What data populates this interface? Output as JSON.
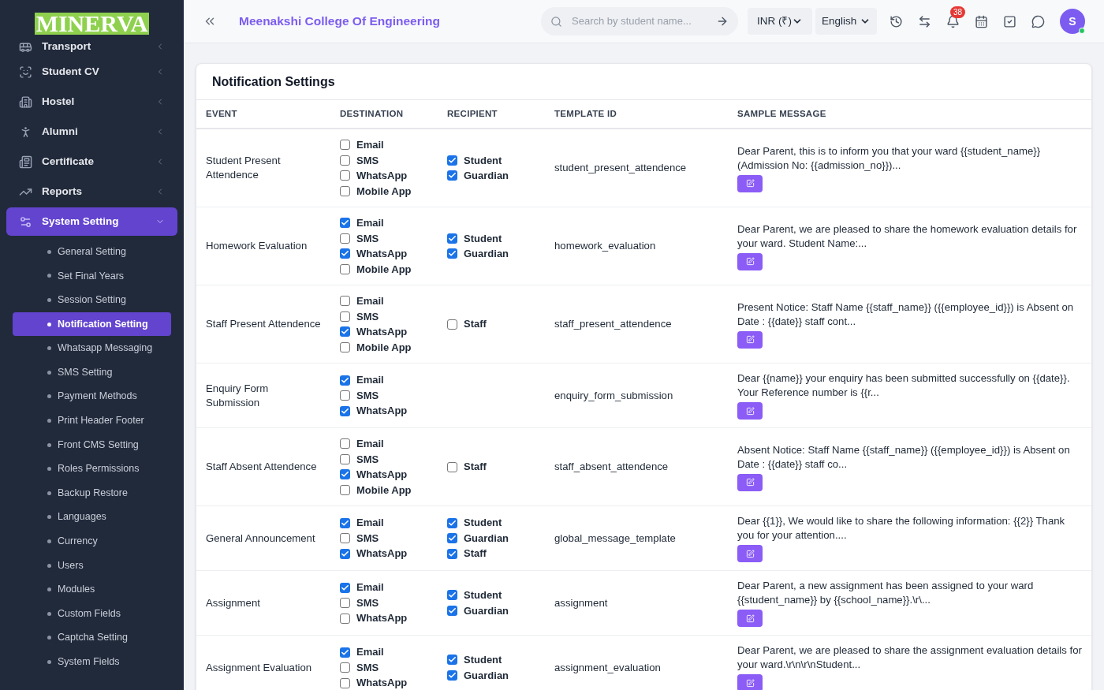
{
  "logo": "MINERVA",
  "sidebar": {
    "items": [
      {
        "label": "Transport",
        "expanded": false
      },
      {
        "label": "Student CV",
        "expanded": false
      },
      {
        "label": "Hostel",
        "expanded": false
      },
      {
        "label": "Alumni",
        "expanded": false
      },
      {
        "label": "Certificate",
        "expanded": false
      },
      {
        "label": "Reports",
        "expanded": false
      },
      {
        "label": "System Setting",
        "expanded": true,
        "children": [
          {
            "label": "General Setting",
            "selected": false
          },
          {
            "label": "Set Final Years",
            "selected": false
          },
          {
            "label": "Session Setting",
            "selected": false
          },
          {
            "label": "Notification Setting",
            "selected": true
          },
          {
            "label": "Whatsapp Messaging",
            "selected": false
          },
          {
            "label": "SMS Setting",
            "selected": false
          },
          {
            "label": "Payment Methods",
            "selected": false
          },
          {
            "label": "Print Header Footer",
            "selected": false
          },
          {
            "label": "Front CMS Setting",
            "selected": false
          },
          {
            "label": "Roles Permissions",
            "selected": false
          },
          {
            "label": "Backup Restore",
            "selected": false
          },
          {
            "label": "Languages",
            "selected": false
          },
          {
            "label": "Currency",
            "selected": false
          },
          {
            "label": "Users",
            "selected": false
          },
          {
            "label": "Modules",
            "selected": false
          },
          {
            "label": "Custom Fields",
            "selected": false
          },
          {
            "label": "Captcha Setting",
            "selected": false
          },
          {
            "label": "System Fields",
            "selected": false
          }
        ]
      }
    ]
  },
  "header": {
    "title": "Meenakshi College Of Engineering",
    "search": {
      "placeholder": "Search by student name..."
    },
    "currency": "INR (₹)",
    "language": "English",
    "notification_count": "38",
    "avatar": "S"
  },
  "card": {
    "title": "Notification Settings",
    "table": {
      "columns": [
        "EVENT",
        "DESTINATION",
        "RECIPIENT",
        "TEMPLATE ID",
        "SAMPLE MESSAGE"
      ],
      "rows": [
        {
          "event": "Student Present Attendence",
          "destination": [
            {
              "label": "Email",
              "checked": false
            },
            {
              "label": "SMS",
              "checked": false
            },
            {
              "label": "WhatsApp",
              "checked": false
            },
            {
              "label": "Mobile App",
              "checked": false
            }
          ],
          "recipient": [
            {
              "label": "Student",
              "checked": true
            },
            {
              "label": "Guardian",
              "checked": true
            }
          ],
          "template_id": "student_present_attendence",
          "message": "Dear Parent, this is to inform you that your ward {{student_name}} (Admission No: {{admission_no}})..."
        },
        {
          "event": "Homework Evaluation",
          "destination": [
            {
              "label": "Email",
              "checked": true
            },
            {
              "label": "SMS",
              "checked": false
            },
            {
              "label": "WhatsApp",
              "checked": true
            },
            {
              "label": "Mobile App",
              "checked": false
            }
          ],
          "recipient": [
            {
              "label": "Student",
              "checked": true
            },
            {
              "label": "Guardian",
              "checked": true
            }
          ],
          "template_id": "homework_evaluation",
          "message": "Dear Parent, we are pleased to share the homework evaluation details for your ward. Student Name:..."
        },
        {
          "event": "Staff Present Attendence",
          "destination": [
            {
              "label": "Email",
              "checked": false
            },
            {
              "label": "SMS",
              "checked": false
            },
            {
              "label": "WhatsApp",
              "checked": true
            },
            {
              "label": "Mobile App",
              "checked": false
            }
          ],
          "recipient": [
            {
              "label": "Staff",
              "checked": false
            }
          ],
          "template_id": "staff_present_attendence",
          "message": "Present Notice: Staff Name {{staff_name}} ({{employee_id}}) is Absent on Date : {{date}} staff cont..."
        },
        {
          "event": "Enquiry Form Submission",
          "destination": [
            {
              "label": "Email",
              "checked": true
            },
            {
              "label": "SMS",
              "checked": false
            },
            {
              "label": "WhatsApp",
              "checked": true
            }
          ],
          "recipient": [],
          "template_id": "enquiry_form_submission",
          "message": "Dear {{name}} your enquiry has been submitted successfully on {{date}}. Your Reference number is {{r..."
        },
        {
          "event": "Staff Absent Attendence",
          "destination": [
            {
              "label": "Email",
              "checked": false
            },
            {
              "label": "SMS",
              "checked": false
            },
            {
              "label": "WhatsApp",
              "checked": true
            },
            {
              "label": "Mobile App",
              "checked": false
            }
          ],
          "recipient": [
            {
              "label": "Staff",
              "checked": false
            }
          ],
          "template_id": "staff_absent_attendence",
          "message": "Absent Notice: Staff Name {{staff_name}} ({{employee_id}}) is Absent on Date : {{date}} staff co..."
        },
        {
          "event": "General Announcement",
          "destination": [
            {
              "label": "Email",
              "checked": true
            },
            {
              "label": "SMS",
              "checked": false
            },
            {
              "label": "WhatsApp",
              "checked": true
            }
          ],
          "recipient": [
            {
              "label": "Student",
              "checked": true
            },
            {
              "label": "Guardian",
              "checked": true
            },
            {
              "label": "Staff",
              "checked": true
            }
          ],
          "template_id": "global_message_template",
          "message": "Dear {{1}}, We would like to share the following information: {{2}} Thank you for your attention...."
        },
        {
          "event": "Assignment",
          "destination": [
            {
              "label": "Email",
              "checked": true
            },
            {
              "label": "SMS",
              "checked": false
            },
            {
              "label": "WhatsApp",
              "checked": false
            }
          ],
          "recipient": [
            {
              "label": "Student",
              "checked": true
            },
            {
              "label": "Guardian",
              "checked": true
            }
          ],
          "template_id": "assignment",
          "message": "Dear Parent, a new assignment has been assigned to your ward {{student_name}} by {{school_name}}.\\r\\..."
        },
        {
          "event": "Assignment Evaluation",
          "destination": [
            {
              "label": "Email",
              "checked": true
            },
            {
              "label": "SMS",
              "checked": false
            },
            {
              "label": "WhatsApp",
              "checked": false
            }
          ],
          "recipient": [
            {
              "label": "Student",
              "checked": true
            },
            {
              "label": "Guardian",
              "checked": true
            }
          ],
          "template_id": "assignment_evaluation",
          "message": "Dear Parent, we are pleased to share the assignment evaluation details for your ward.\\r\\n\\r\\nStudent..."
        }
      ]
    }
  }
}
